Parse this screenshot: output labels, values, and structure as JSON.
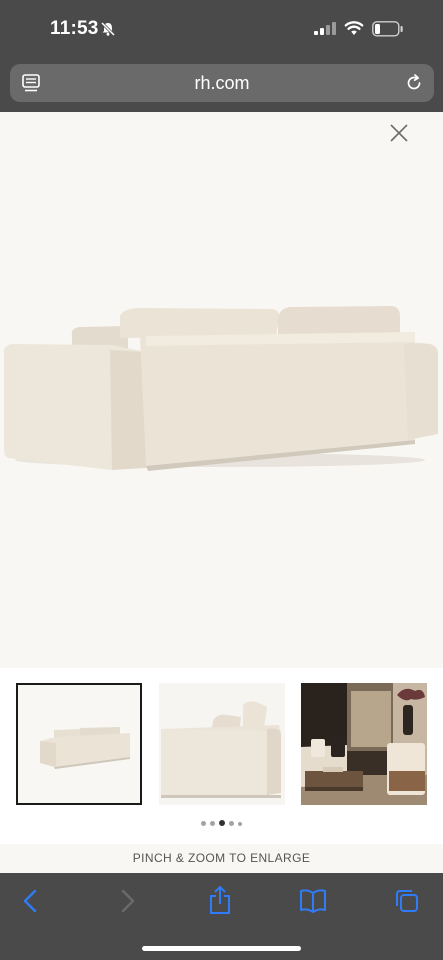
{
  "status_bar": {
    "time": "11:53"
  },
  "browser": {
    "url": "rh.com"
  },
  "gallery": {
    "thumbnails": [
      {
        "name": "sofa-back-view",
        "selected": true
      },
      {
        "name": "sofa-side-view",
        "selected": false
      },
      {
        "name": "sofa-room-scene",
        "selected": false
      }
    ],
    "page_dots": 5,
    "active_dot": 3,
    "hint": "PINCH & ZOOM TO ENLARGE"
  },
  "colors": {
    "chrome": "#4a4a4a",
    "accent": "#2f7cf6",
    "sofa": "#ebe3d6"
  }
}
